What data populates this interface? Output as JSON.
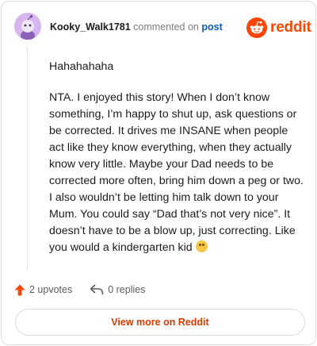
{
  "comment": {
    "username": "Kooky_Walk1781",
    "action_text": "commented on",
    "link_text": "post",
    "paragraphs": [
      "Hahahahaha",
      "NTA. I enjoyed this story! When I don’t know something, I’m happy to shut up, ask questions or be corrected. It drives me INSANE when people act like they know everything, when they actually know very little. Maybe your Dad needs to be corrected more often, bring him down a peg or two. I also wouldn’t be letting him talk down to your Mum. You could say “Dad that’s not very nice”. It doesn’t have to be a blow up, just correcting. Like you would a kindergarten kid"
    ],
    "emoji": "winking-tongue-emoji"
  },
  "brand": {
    "name": "reddit",
    "color": "#ff4500"
  },
  "stats": {
    "upvotes_label": "2 upvotes",
    "replies_label": "0 replies"
  },
  "footer": {
    "view_more_label": "View more on Reddit"
  },
  "colors": {
    "avatar_bg": "#d7b5ee",
    "upvote": "#ff4500",
    "link": "#0a5bbf",
    "view_more_text": "#d93a00"
  }
}
